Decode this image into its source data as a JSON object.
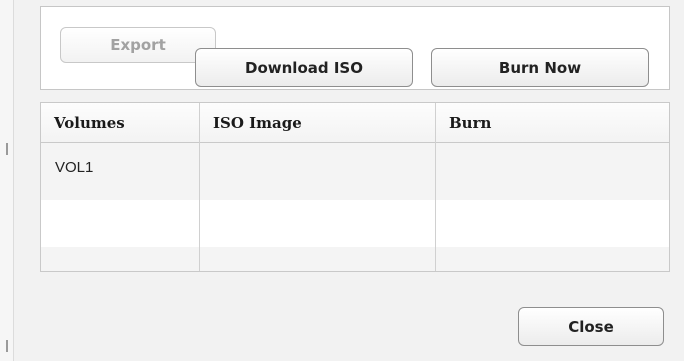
{
  "export_panel": {
    "export_label": "Export"
  },
  "iso_table": {
    "columns": [
      "Volumes",
      "ISO Image",
      "Burn"
    ],
    "rows": [
      {
        "volume": "VOL1",
        "iso_action_label": "Download ISO",
        "burn_action_label": "Burn Now"
      }
    ]
  },
  "footer": {
    "close_label": "Close"
  },
  "colors": {
    "dialog_background": "#f2f2f2",
    "panel_background": "#ffffff",
    "table_stripe": "#f4f4f4",
    "border": "#c9c9c9",
    "button_border": "#8e8e8e",
    "disabled_text": "#a2a2a2"
  }
}
